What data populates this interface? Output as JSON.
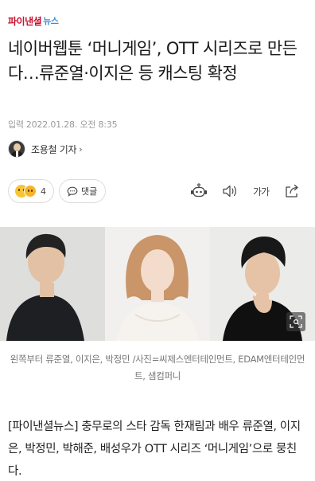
{
  "header": {
    "logo_main": "파이낸셜",
    "logo_sub": "뉴스"
  },
  "article": {
    "headline": "네이버웹툰 ‘머니게임’, OTT 시리즈로 만든다…류준열·이지은 등 캐스팅 확정",
    "date_label": "입력",
    "date_value": "2022.01.28. 오전 8:35",
    "reporter_name": "조용철 기자",
    "reporter_chevron": "›",
    "reaction_count": "4",
    "comment_label": "댓글",
    "font_size_label": "가가",
    "caption": "왼쪽부터 류준열, 이지은, 박정민 /사진=씨제스엔터테인먼트, EDAM엔터테인먼트, 샘컴퍼니",
    "body": "[파이낸셜뉴스] 충무로의 스타 감독 한재림과 배우 류준열, 이지은, 박정민, 박해준, 배성우가 OTT 시리즈 ‘머니게임’으로 뭉친다."
  },
  "icons": {
    "reaction": "emoji-reaction-icon",
    "comment": "speech-bubble-icon",
    "tts": "robot-voice-icon",
    "audio": "speaker-icon",
    "font": "font-size-icon",
    "share": "share-icon",
    "expand": "expand-image-icon"
  },
  "colors": {
    "logo_red": "#c8102e",
    "logo_blue": "#3f8fd2",
    "caption_gray": "#777777"
  }
}
